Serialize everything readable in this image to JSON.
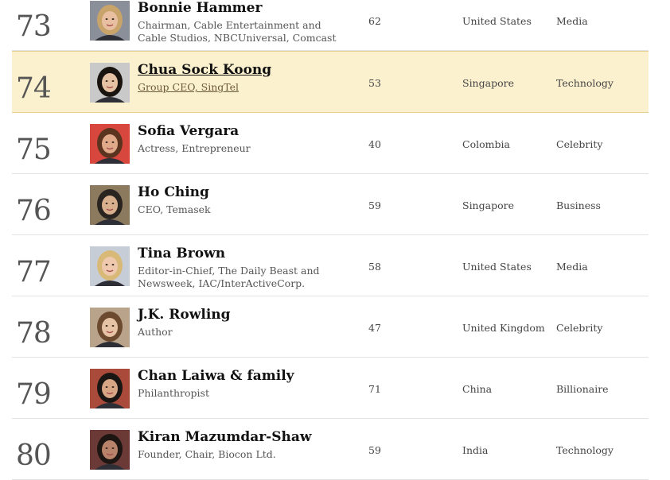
{
  "rows": [
    {
      "rank": "73",
      "name": "Bonnie Hammer",
      "title": "Chairman, Cable Entertainment and Cable Studios, NBCUniversal, Comcast",
      "age": "62",
      "country": "United States",
      "category": "Media",
      "photo": "photo-bonnie-hammer",
      "hair": "#c9a46a",
      "bg": "#8a8f99",
      "skin": "#e8bfa0"
    },
    {
      "rank": "74",
      "name": "Chua Sock Koong",
      "title": "Group CEO, SingTel",
      "age": "53",
      "country": "Singapore",
      "category": "Technology",
      "photo": "photo-chua-sock-koong",
      "hair": "#1a1410",
      "bg": "#c9c9c9",
      "skin": "#e6c2a4"
    },
    {
      "rank": "75",
      "name": "Sofia Vergara",
      "title": "Actress, Entrepreneur",
      "age": "40",
      "country": "Colombia",
      "category": "Celebrity",
      "photo": "photo-sofia-vergara",
      "hair": "#5b3420",
      "bg": "#d8473d",
      "skin": "#e0a98a"
    },
    {
      "rank": "76",
      "name": "Ho Ching",
      "title": "CEO, Temasek",
      "age": "59",
      "country": "Singapore",
      "category": "Business",
      "photo": "photo-ho-ching",
      "hair": "#2a2420",
      "bg": "#8c7a5e",
      "skin": "#d9b08e"
    },
    {
      "rank": "77",
      "name": "Tina Brown",
      "title": "Editor-in-Chief, The Daily Beast and Newsweek, IAC/InterActiveCorp.",
      "age": "58",
      "country": "United States",
      "category": "Media",
      "photo": "photo-tina-brown",
      "hair": "#d9b977",
      "bg": "#c7cdd6",
      "skin": "#eec9ad"
    },
    {
      "rank": "78",
      "name": "J.K. Rowling",
      "title": "Author",
      "age": "47",
      "country": "United Kingdom",
      "category": "Celebrity",
      "photo": "photo-jk-rowling",
      "hair": "#6b4a30",
      "bg": "#b9a38a",
      "skin": "#e7c3a5"
    },
    {
      "rank": "79",
      "name": "Chan Laiwa & family",
      "title": "Philanthropist",
      "age": "71",
      "country": "China",
      "category": "Billionaire",
      "photo": "photo-chan-laiwa",
      "hair": "#1a1614",
      "bg": "#a94a3a",
      "skin": "#d7a684"
    },
    {
      "rank": "80",
      "name": "Kiran Mazumdar-Shaw",
      "title": "Founder, Chair, Biocon Ltd.",
      "age": "59",
      "country": "India",
      "category": "Technology",
      "photo": "photo-kiran-mazumdar-shaw",
      "hair": "#1d1512",
      "bg": "#6b3a36",
      "skin": "#b8836a"
    }
  ]
}
